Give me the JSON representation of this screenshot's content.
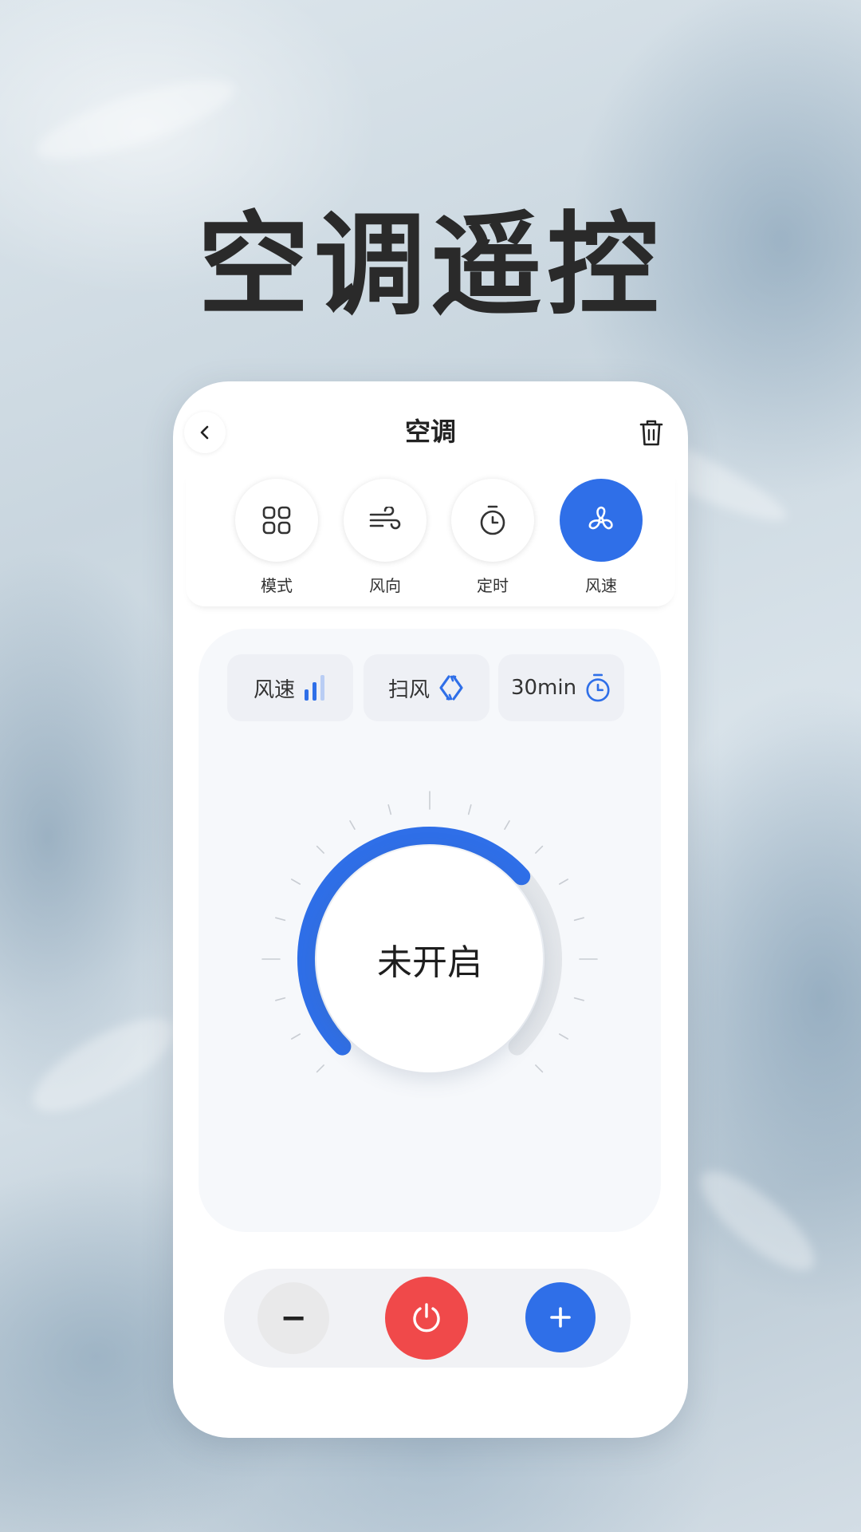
{
  "hero": {
    "title": "空调遥控"
  },
  "nav": {
    "title": "空调"
  },
  "functions": [
    {
      "label": "模式",
      "icon": "grid-icon",
      "active": false
    },
    {
      "label": "风向",
      "icon": "wind-direction-icon",
      "active": false
    },
    {
      "label": "定时",
      "icon": "timer-icon",
      "active": false
    },
    {
      "label": "风速",
      "icon": "fan-icon",
      "active": true
    }
  ],
  "chips": [
    {
      "label": "风速",
      "icon": "signal-bars-icon"
    },
    {
      "label": "扫风",
      "icon": "swing-icon"
    },
    {
      "label": "30min",
      "icon": "timer-icon"
    }
  ],
  "dial": {
    "status": "未开启"
  },
  "controls": {
    "minus_label": "−"
  },
  "colors": {
    "accent": "#2f6fe8",
    "power": "#f0494a",
    "text": "#222222"
  }
}
